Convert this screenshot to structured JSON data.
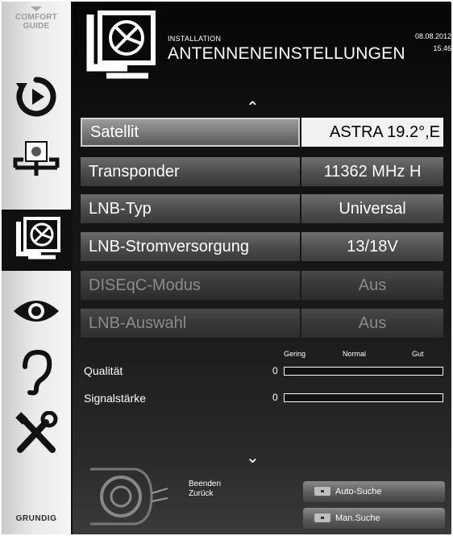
{
  "sidebar": {
    "comfort_guide": "COMFORT\nGUIDE",
    "comfort_line1": "COMFORT",
    "comfort_line2": "GUIDE",
    "items": [
      {
        "icon": "playback-icon",
        "active": false
      },
      {
        "icon": "source-connection-icon",
        "active": false
      },
      {
        "icon": "installation-satellite-icon",
        "active": true
      },
      {
        "icon": "eye-icon",
        "active": false
      },
      {
        "icon": "ear-icon",
        "active": false
      },
      {
        "icon": "tools-icon",
        "active": false
      }
    ],
    "brand": "GRUNDIG"
  },
  "header": {
    "section": "INSTALLATION",
    "title": "ANTENNENEINSTELLUNGEN",
    "date": "08.08.2012",
    "time": "15.46"
  },
  "settings": [
    {
      "label": "Satellit",
      "value": "ASTRA 19.2°,E",
      "state": "selected"
    },
    {
      "label": "Transponder",
      "value": "11362 MHz H",
      "state": "normal"
    },
    {
      "label": "LNB-Typ",
      "value": "Universal",
      "state": "normal"
    },
    {
      "label": "LNB-Stromversorgung",
      "value": "13/18V",
      "state": "normal"
    },
    {
      "label": "DISEqC-Modus",
      "value": "Aus",
      "state": "disabled"
    },
    {
      "label": "LNB-Auswahl",
      "value": "Aus",
      "state": "disabled"
    }
  ],
  "signal": {
    "scale": [
      "Gering",
      "Normal",
      "Gut"
    ],
    "quality": {
      "label": "Qualität",
      "value": "0",
      "fraction": 0
    },
    "strength": {
      "label": "Signalstärke",
      "value": "0",
      "fraction": 0
    }
  },
  "help": {
    "exit": "Beenden",
    "back": "Zurück"
  },
  "buttons": {
    "auto_search": "Auto-Suche",
    "manual_search": "Man.Suche"
  },
  "colors": {
    "background": "#1b1b1b",
    "sidebar": "#e9e9e9",
    "selected_value_bg": "#f2f2f2",
    "text": "#ffffff",
    "disabled_text": "#8b8b8b"
  }
}
